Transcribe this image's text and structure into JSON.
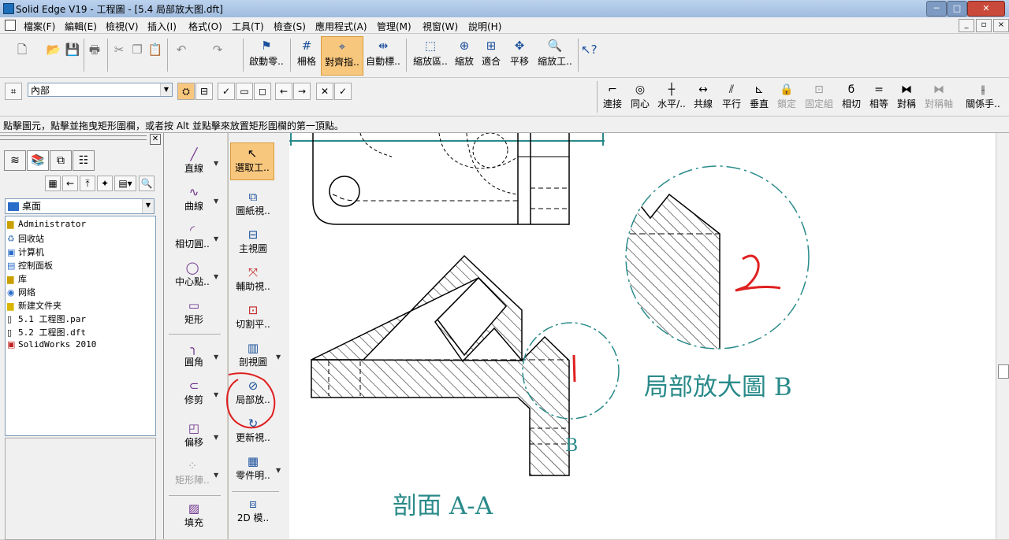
{
  "window": {
    "title": "Solid Edge V19 - 工程圖 - [5.4 局部放大图.dft]",
    "controls": [
      "─",
      "□",
      "✕"
    ]
  },
  "mdi_controls": [
    "_",
    "▫",
    "×"
  ],
  "menu": [
    "檔案(F)",
    "編輯(E)",
    "檢視(V)",
    "插入(I)",
    "格式(O)",
    "工具(T)",
    "檢查(S)",
    "應用程式(A)",
    "管理(M)",
    "視窗(W)",
    "說明(H)"
  ],
  "toolbar1": {
    "labeled_buttons": [
      "啟動零..",
      "柵格",
      "對齊指..",
      "自動標..",
      "縮放區..",
      "縮放",
      "適合",
      "平移",
      "縮放工.."
    ],
    "active_index": 2
  },
  "toolbar2": {
    "layer_combo_value": "內部",
    "relations": [
      "連接",
      "同心",
      "水平/..",
      "共線",
      "平行",
      "垂直",
      "鎖定",
      "固定組",
      "相切",
      "相等",
      "對稱",
      "對稱軸",
      "關係手.."
    ],
    "disabled_relations": [
      "鎖定",
      "固定組",
      "對稱軸"
    ]
  },
  "status_text": "點擊圖元，點擊並拖曳矩形圍欄，或者按 Alt 並點擊來放置矩形圍欄的第一頂點。",
  "explorer": {
    "location": "桌面",
    "items": [
      "Administrator",
      "回收站",
      "计算机",
      "控制面板",
      "库",
      "网络",
      "新建文件夹",
      "5.1 工程图.par",
      "5.2 工程图.dft",
      "SolidWorks 2010"
    ]
  },
  "draw_tools": [
    "直線",
    "曲線",
    "相切圓..",
    "中心點..",
    "矩形",
    "圓角",
    "修剪",
    "偏移",
    "矩形陣..",
    "填充"
  ],
  "view_tools": [
    "選取工..",
    "圖紙視..",
    "主視圖",
    "輔助視..",
    "切割平..",
    "剖視圖",
    "局部放..",
    "更新視..",
    "零件明..",
    "2D 模.."
  ],
  "drawing": {
    "section_label": "剖面 A-A",
    "detail_label": "局部放大圖 B",
    "detail_marker": "B",
    "annotation_1": "1",
    "annotation_2": "2",
    "colors": {
      "teal": "#2a8a8a",
      "red": "#e02020",
      "active": "#f8c77e"
    }
  }
}
